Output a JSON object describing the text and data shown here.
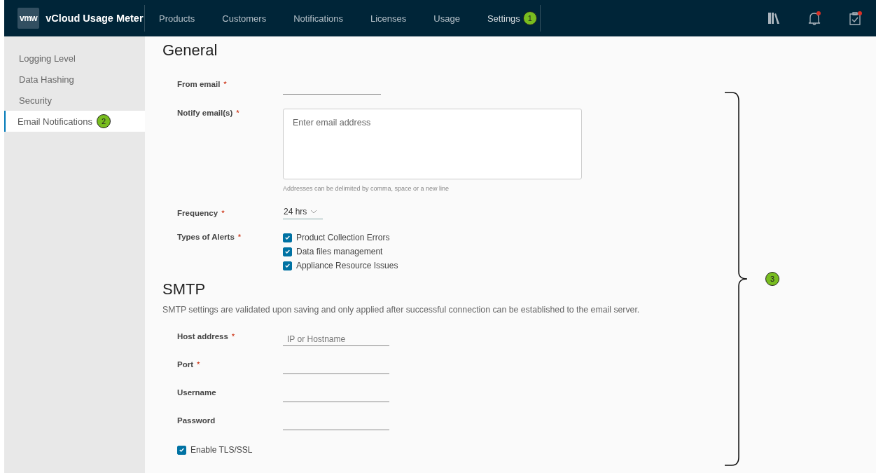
{
  "header": {
    "logo": "vmw",
    "app_name": "vCloud Usage Meter",
    "nav": [
      {
        "label": "Products",
        "selected": false
      },
      {
        "label": "Customers",
        "selected": false
      },
      {
        "label": "Notifications",
        "selected": false
      },
      {
        "label": "Licenses",
        "selected": false
      },
      {
        "label": "Usage",
        "selected": false
      },
      {
        "label": "Settings",
        "selected": true,
        "callout": "1"
      }
    ],
    "icons": [
      {
        "kind": "library",
        "alert": false
      },
      {
        "kind": "bell",
        "alert": true
      },
      {
        "kind": "tasks",
        "alert": true
      }
    ]
  },
  "sidebar": {
    "items": [
      {
        "label": "Logging Level",
        "selected": false
      },
      {
        "label": "Data Hashing",
        "selected": false
      },
      {
        "label": "Security",
        "selected": false
      },
      {
        "label": "Email Notifications",
        "selected": true,
        "callout": "2"
      }
    ]
  },
  "general": {
    "title": "General",
    "from_email": {
      "label": "From email",
      "required_mark": "*"
    },
    "notify_emails": {
      "label": "Notify email(s)",
      "required_mark": "*",
      "placeholder": "Enter email address",
      "hint": "Addresses can be delimited by comma, space or a new line"
    },
    "frequency": {
      "label": "Frequency",
      "required_mark": "*",
      "value": "24 hrs"
    },
    "alerts": {
      "label": "Types of Alerts",
      "required_mark": "*",
      "options": [
        {
          "label": "Product Collection Errors",
          "checked": true
        },
        {
          "label": "Data files management",
          "checked": true
        },
        {
          "label": "Appliance Resource Issues",
          "checked": true
        }
      ]
    }
  },
  "smtp": {
    "title": "SMTP",
    "description": "SMTP settings are validated upon saving and only applied after successful connection can be established to the email server.",
    "fields": [
      {
        "label": "Host address",
        "required_mark": "*",
        "placeholder": "IP or Hostname"
      },
      {
        "label": "Port",
        "required_mark": "*"
      },
      {
        "label": "Username"
      },
      {
        "label": "Password"
      }
    ],
    "tls": {
      "label": "Enable TLS/SSL",
      "checked": true
    }
  },
  "annotation": {
    "callout": "3"
  }
}
